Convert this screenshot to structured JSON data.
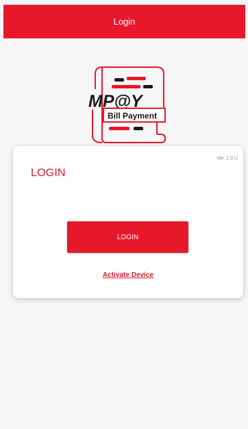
{
  "header": {
    "title": "Login"
  },
  "logo": {
    "brand_text": "MP@Y",
    "tagline": "Bill Payment",
    "accent_color": "#e8182b",
    "ink_color": "#1a1a1a"
  },
  "card": {
    "version": "Ver. 1.0 U",
    "title": "LOGIN",
    "login_button_label": "LOGIN",
    "activate_link": "Activate Device"
  },
  "colors": {
    "primary": "#e8182b",
    "background": "#f6f6f6",
    "card": "#ffffff"
  }
}
